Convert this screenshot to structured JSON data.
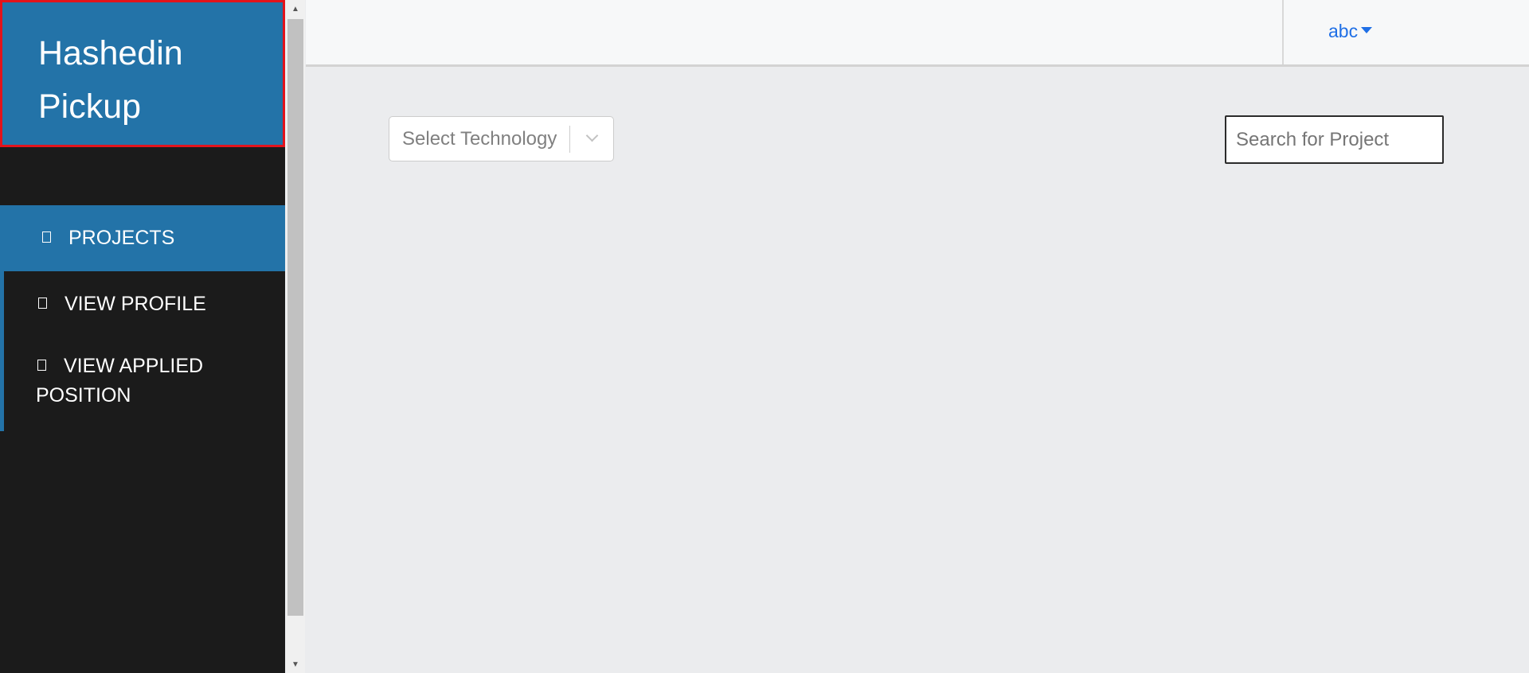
{
  "sidebar": {
    "brand_line1": "Hashedin",
    "brand_line2": "Pickup",
    "items": [
      {
        "label": "PROJECTS",
        "icon": "projects-icon"
      },
      {
        "label": "VIEW PROFILE",
        "icon": "profile-icon"
      },
      {
        "label": "VIEW APPLIED",
        "label2": "POSITION",
        "icon": "applied-icon"
      }
    ]
  },
  "header": {
    "user_name": "abc"
  },
  "filters": {
    "technology_placeholder": "Select Technology",
    "search_placeholder": "Search for Project"
  },
  "colors": {
    "brand_blue": "#2373a8",
    "sidebar_bg": "#1b1b1b",
    "link_blue": "#1f6fe6",
    "highlight_border": "#e3131b"
  }
}
